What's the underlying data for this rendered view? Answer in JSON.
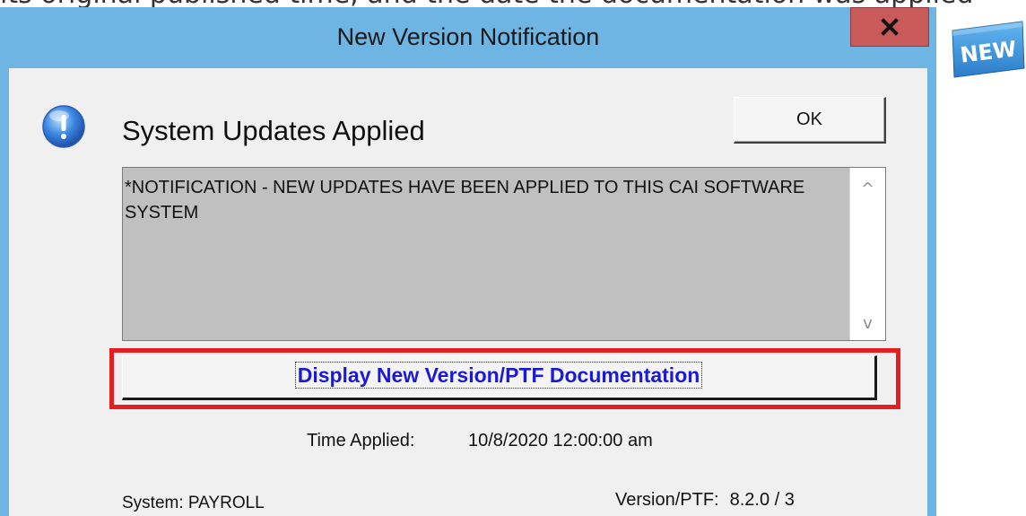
{
  "background_caption": "its original published time, and the date the documentation was applied",
  "window": {
    "title": "New Version Notification",
    "close_symbol": "x"
  },
  "dialog": {
    "heading": "System Updates Applied",
    "ok_label": "OK",
    "message": "*NOTIFICATION - NEW UPDATES HAVE BEEN APPLIED TO THIS CAI SOFTWARE SYSTEM",
    "scroll_up_symbol": "^",
    "scroll_down_symbol": "v",
    "doc_button_label": "Display New Version/PTF Documentation",
    "time_applied_label": "Time Applied:",
    "time_applied_value": "10/8/2020 12:00:00 am",
    "system_label": "System: PAYROLL",
    "version_label": "Version/PTF:",
    "version_value": "8.2.0 / 3"
  },
  "badge": {
    "text": "NEW"
  },
  "colors": {
    "frame": "#6fb5e3",
    "client": "#f0f0f0",
    "close_button": "#c85a5a",
    "message_box": "#c0c0c0",
    "highlight": "#e32020",
    "link_text": "#1a1ad8",
    "badge": "#3a8fd8"
  },
  "icons": {
    "info": "info-icon",
    "close": "close-icon",
    "badge": "new-badge-icon"
  }
}
